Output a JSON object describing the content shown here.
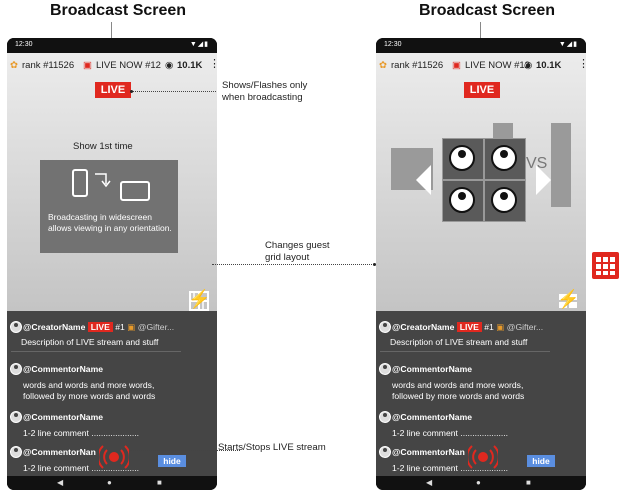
{
  "headings": {
    "left": "Broadcast Screen",
    "right": "Broadcast Screen"
  },
  "status": {
    "time": "12:30"
  },
  "topbar": {
    "rank": "rank #11526",
    "live_now": "LIVE NOW #12",
    "viewers": "10.1K"
  },
  "live_badge": "LIVE",
  "tip": {
    "title": "Show 1st time",
    "body": "Broadcasting in widescreen allows viewing in any orientation."
  },
  "comments": {
    "creator": "@CreatorName",
    "creator_live": "LIVE",
    "gift_rank": "#1",
    "gifter": "@Gifter...",
    "description": "Description of LIVE stream and stuff",
    "c1_name": "@CommentorName",
    "c1_text1": "words and words and more words,",
    "c1_text2": "followed by more words and words",
    "c2_name": "@CommentorName",
    "c2_text": "1-2 line comment ....................",
    "c3_name": "@CommentorNan",
    "c3_text": "1-2 line comment ....................",
    "hide": "hide"
  },
  "annotations": {
    "flash_1": "Shows/Flashes only",
    "flash_2": "when broadcasting",
    "grid_1": "Changes guest",
    "grid_2": "grid layout",
    "startstop": "Starts/Stops LIVE stream"
  },
  "vs": "VS",
  "icons": [
    "rank-icon",
    "tv-icon",
    "eye-icon",
    "more-icon",
    "layout-icon",
    "grid-icon",
    "flash-off-icon",
    "timer-icon",
    "music-icon",
    "filter-icon",
    "sparkle-icon",
    "flip-camera-icon",
    "broadcast-icon",
    "back-icon",
    "home-icon",
    "recents-icon"
  ],
  "colors": {
    "live_red": "#e0281f",
    "hide_blue": "#5a8ee0",
    "grid_red": "#e0281f",
    "filter_green": "#7ed957"
  }
}
